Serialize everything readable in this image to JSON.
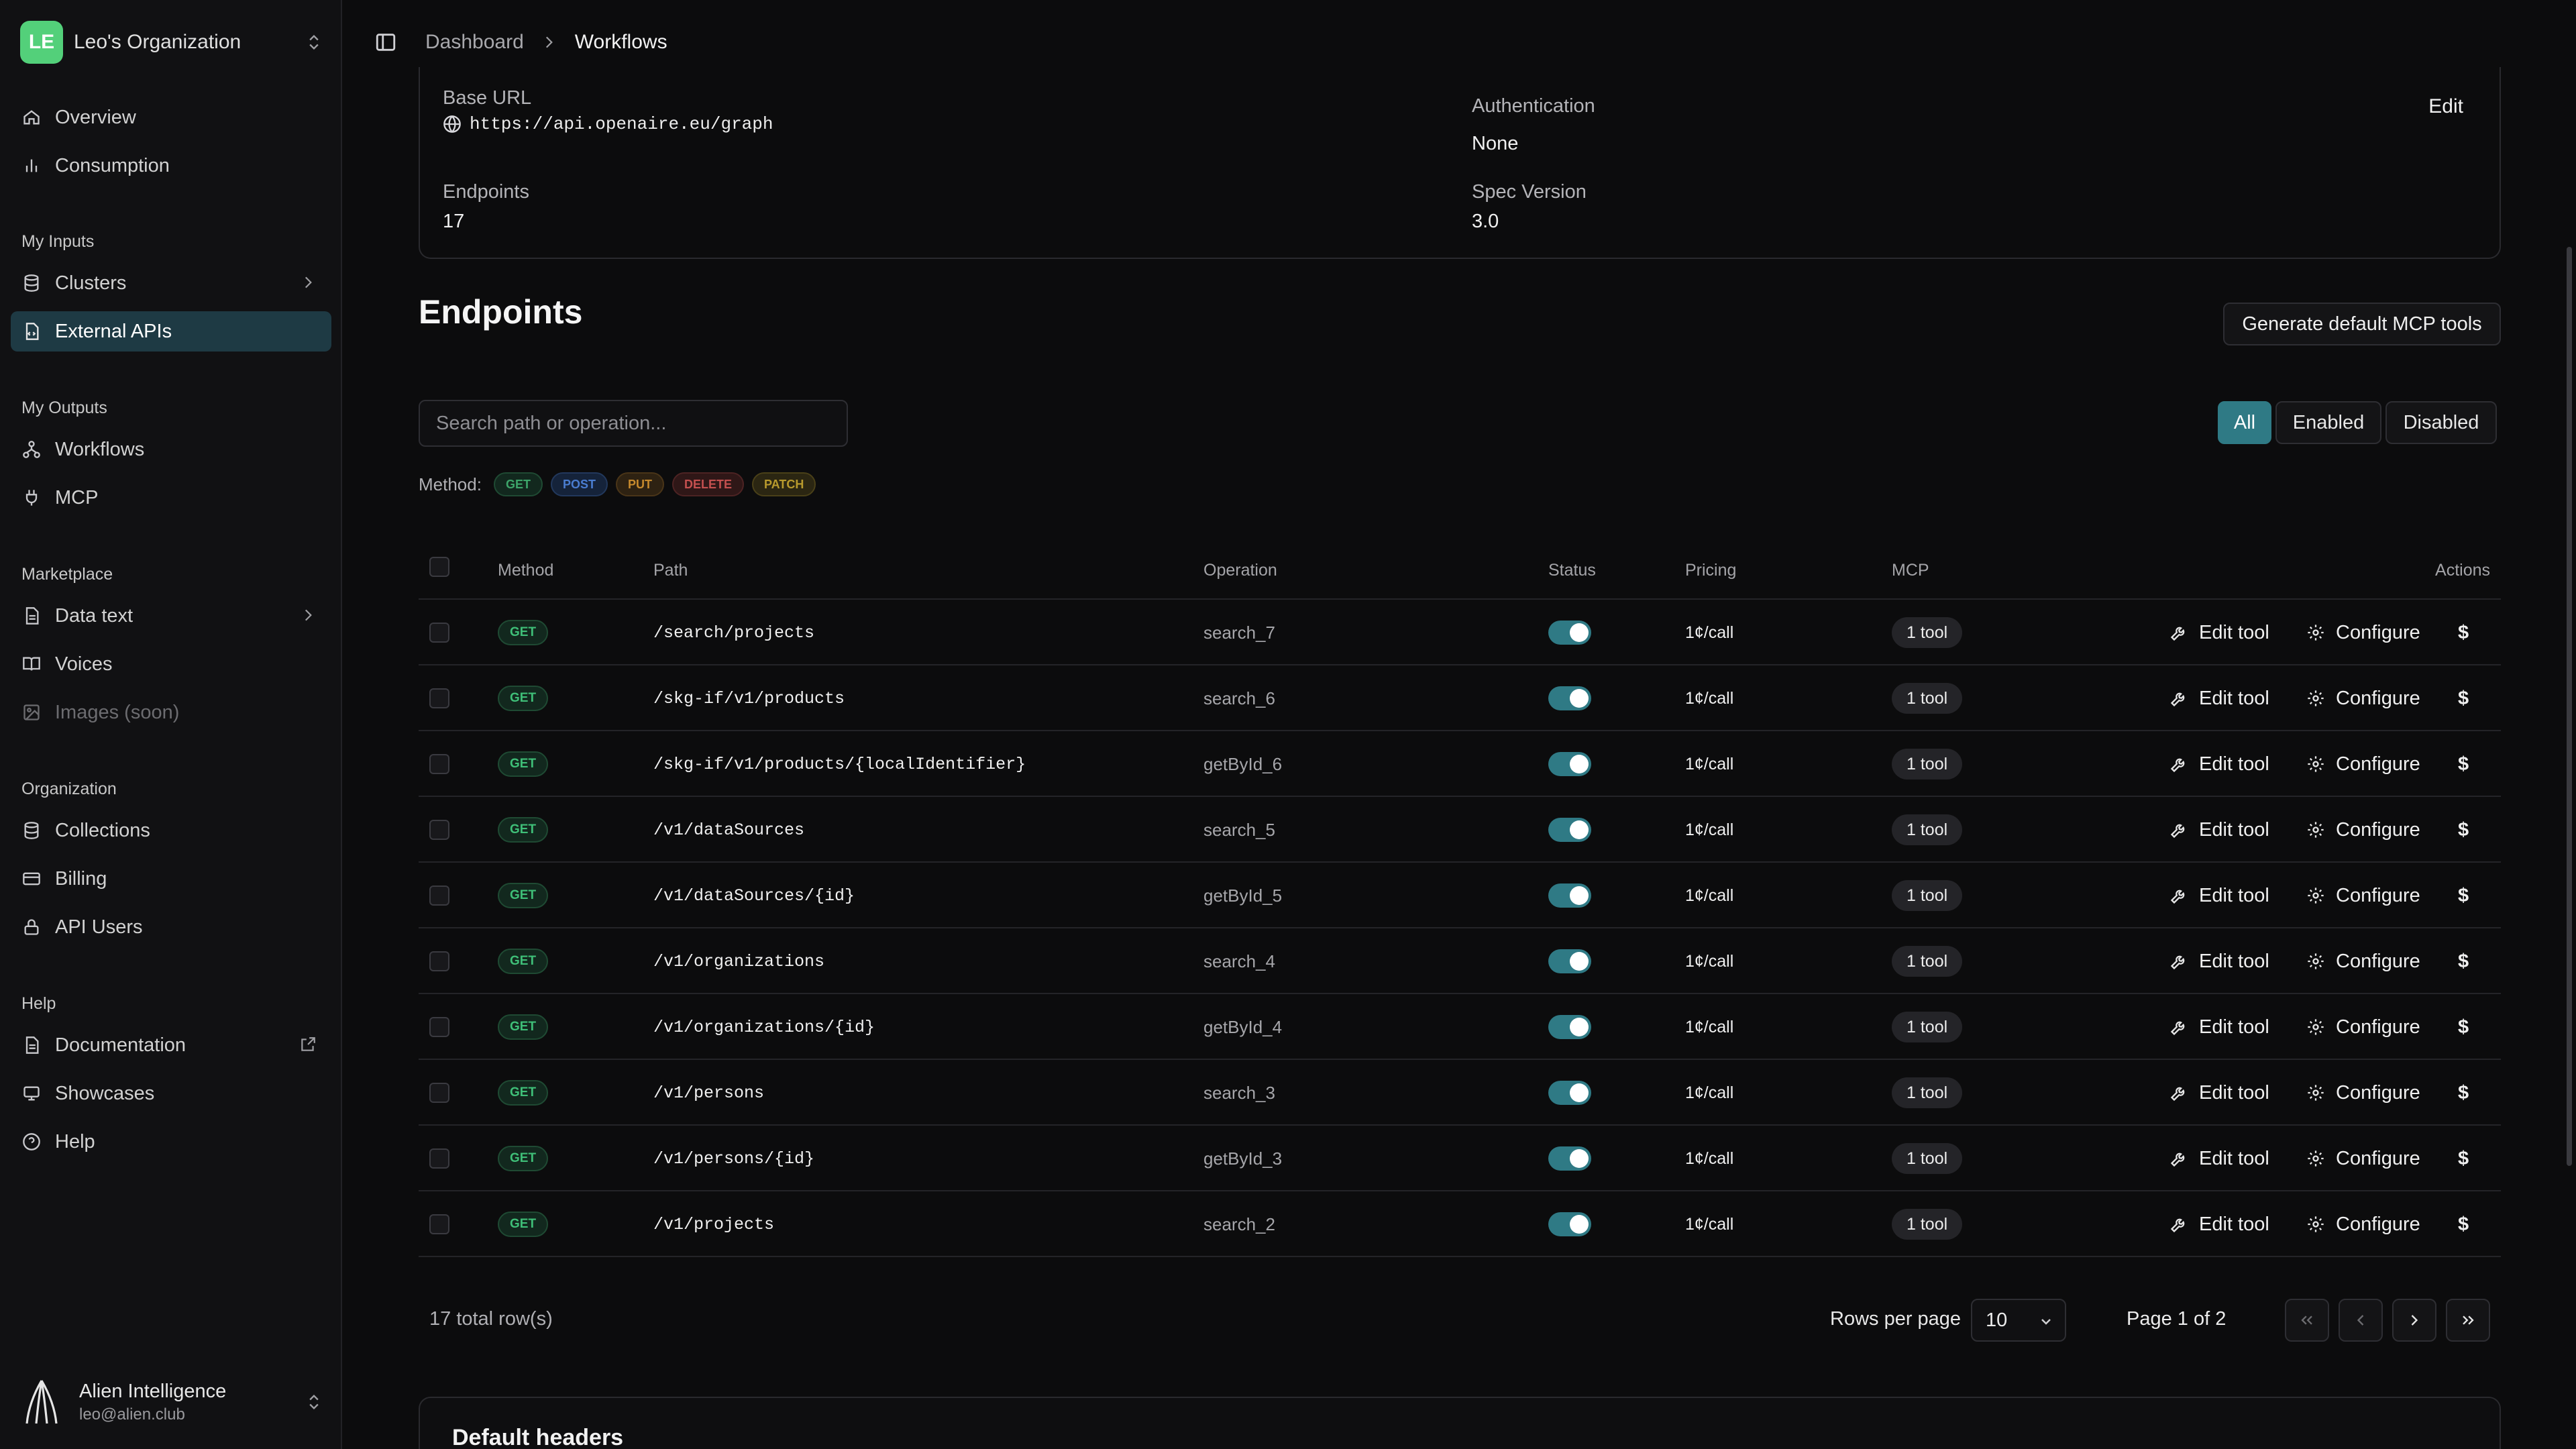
{
  "sidebar": {
    "org": {
      "initials": "LE",
      "name": "Leo's Organization"
    },
    "items_top": [
      {
        "label": "Overview",
        "icon": "home-icon"
      },
      {
        "label": "Consumption",
        "icon": "bar-chart-icon"
      }
    ],
    "sections": {
      "inputs": "My Inputs",
      "outputs": "My Outputs",
      "marketplace": "Marketplace",
      "organization": "Organization",
      "help": "Help"
    },
    "inputs": [
      {
        "label": "Clusters",
        "icon": "database-icon"
      },
      {
        "label": "External APIs",
        "icon": "file-code-icon",
        "active": true
      }
    ],
    "outputs": [
      {
        "label": "Workflows",
        "icon": "workflow-icon"
      },
      {
        "label": "MCP",
        "icon": "plug-icon"
      }
    ],
    "marketplace": [
      {
        "label": "Data text",
        "icon": "document-icon"
      },
      {
        "label": "Voices",
        "icon": "book-icon"
      },
      {
        "label": "Images (soon)",
        "icon": "image-icon"
      }
    ],
    "organization": [
      {
        "label": "Collections",
        "icon": "database-icon"
      },
      {
        "label": "Billing",
        "icon": "credit-card-icon"
      },
      {
        "label": "API Users",
        "icon": "lock-icon"
      }
    ],
    "help": [
      {
        "label": "Documentation",
        "icon": "document-icon"
      },
      {
        "label": "Showcases",
        "icon": "monitor-icon"
      },
      {
        "label": "Help",
        "icon": "help-circle-icon"
      }
    ],
    "user": {
      "name": "Alien Intelligence",
      "email": "leo@alien.club"
    }
  },
  "header": {
    "breadcrumb": [
      "Dashboard",
      "Workflows"
    ]
  },
  "details": {
    "base_url_label": "Base URL",
    "base_url": "https://api.openaire.eu/graph",
    "auth_label": "Authentication",
    "auth_value": "None",
    "edit_label": "Edit",
    "endpoints_label": "Endpoints",
    "endpoints_value": "17",
    "spec_label": "Spec Version",
    "spec_value": "3.0"
  },
  "endpoints": {
    "title": "Endpoints",
    "generate_label": "Generate default MCP tools",
    "search_placeholder": "Search path or operation...",
    "filters": [
      "All",
      "Enabled",
      "Disabled"
    ],
    "active_filter": "All",
    "method_label": "Method:",
    "methods": [
      "GET",
      "POST",
      "PUT",
      "DELETE",
      "PATCH"
    ],
    "columns": [
      "Method",
      "Path",
      "Operation",
      "Status",
      "Pricing",
      "MCP",
      "Actions"
    ],
    "rows": [
      {
        "method": "GET",
        "path": "/search/projects",
        "operation": "search_7",
        "enabled": true,
        "pricing": "1¢/call",
        "mcp": "1 tool"
      },
      {
        "method": "GET",
        "path": "/skg-if/v1/products",
        "operation": "search_6",
        "enabled": true,
        "pricing": "1¢/call",
        "mcp": "1 tool"
      },
      {
        "method": "GET",
        "path": "/skg-if/v1/products/{localIdentifier}",
        "operation": "getById_6",
        "enabled": true,
        "pricing": "1¢/call",
        "mcp": "1 tool"
      },
      {
        "method": "GET",
        "path": "/v1/dataSources",
        "operation": "search_5",
        "enabled": true,
        "pricing": "1¢/call",
        "mcp": "1 tool"
      },
      {
        "method": "GET",
        "path": "/v1/dataSources/{id}",
        "operation": "getById_5",
        "enabled": true,
        "pricing": "1¢/call",
        "mcp": "1 tool"
      },
      {
        "method": "GET",
        "path": "/v1/organizations",
        "operation": "search_4",
        "enabled": true,
        "pricing": "1¢/call",
        "mcp": "1 tool"
      },
      {
        "method": "GET",
        "path": "/v1/organizations/{id}",
        "operation": "getById_4",
        "enabled": true,
        "pricing": "1¢/call",
        "mcp": "1 tool"
      },
      {
        "method": "GET",
        "path": "/v1/persons",
        "operation": "search_3",
        "enabled": true,
        "pricing": "1¢/call",
        "mcp": "1 tool"
      },
      {
        "method": "GET",
        "path": "/v1/persons/{id}",
        "operation": "getById_3",
        "enabled": true,
        "pricing": "1¢/call",
        "mcp": "1 tool"
      },
      {
        "method": "GET",
        "path": "/v1/projects",
        "operation": "search_2",
        "enabled": true,
        "pricing": "1¢/call",
        "mcp": "1 tool"
      }
    ],
    "action_labels": {
      "edit": "Edit tool",
      "configure": "Configure",
      "pricing": "$"
    },
    "footer": {
      "total": "17 total row(s)",
      "rows_per_page_label": "Rows per page",
      "rows_per_page": "10",
      "page_info": "Page 1 of 2"
    }
  },
  "default_headers": {
    "title": "Default headers"
  },
  "colors": {
    "accent": "#2f7a85",
    "active_nav": "#1e3a44",
    "get": "#3fbf78",
    "logo": "#53d07a"
  }
}
